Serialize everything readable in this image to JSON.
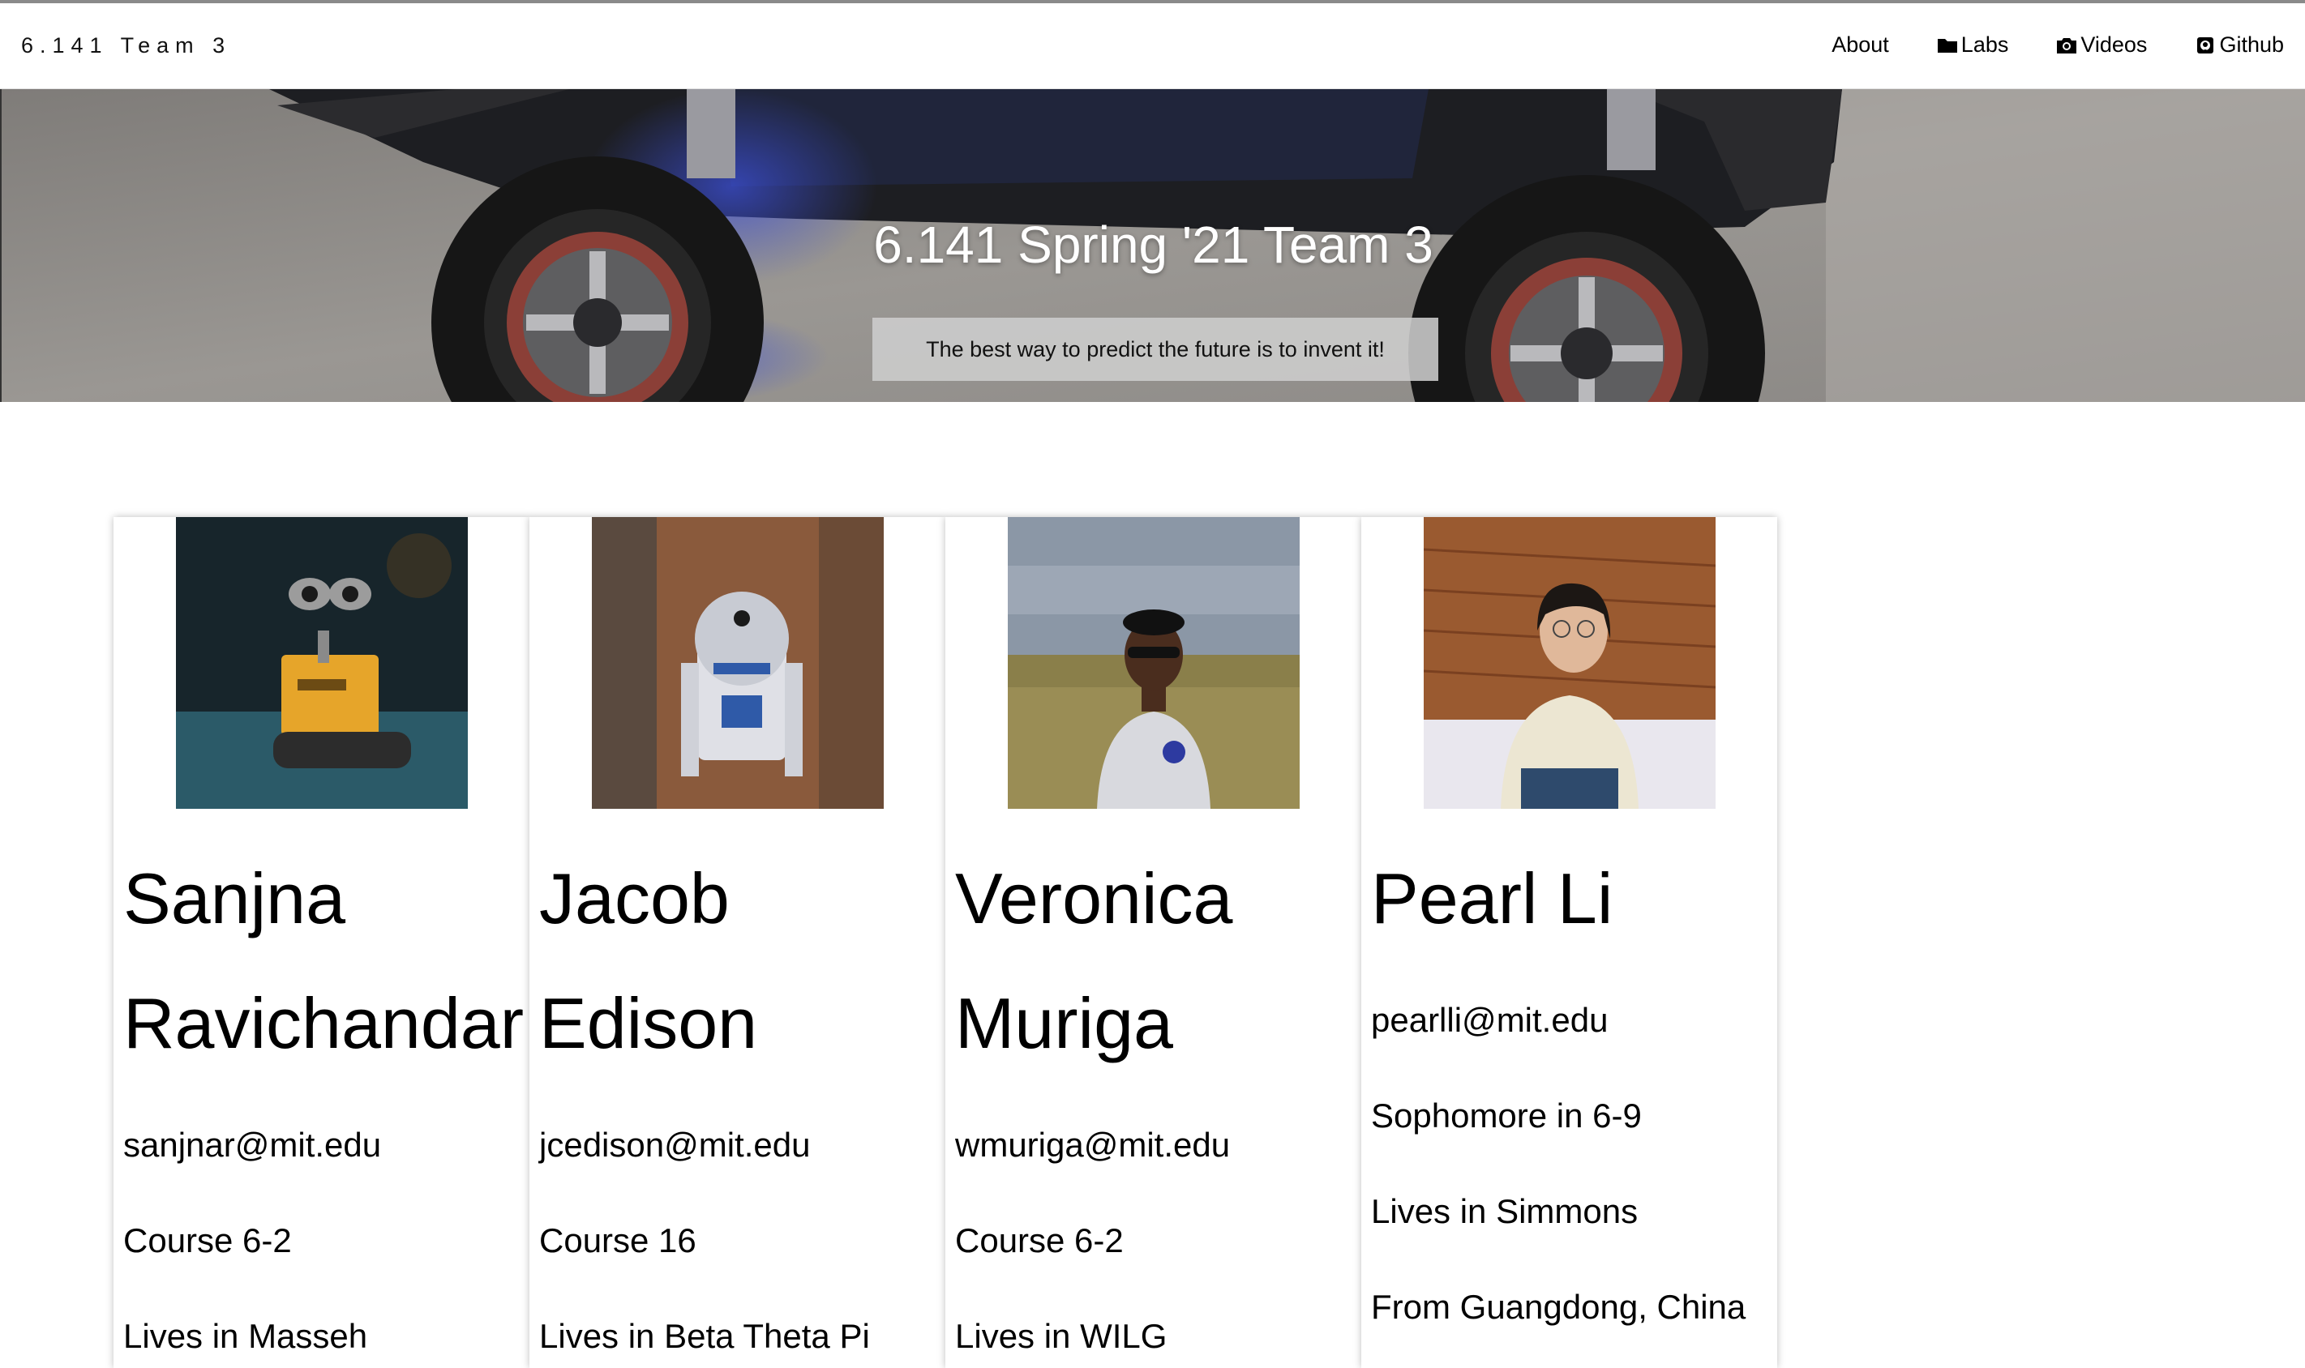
{
  "navbar": {
    "brand": "6.141 Team 3",
    "links": [
      {
        "label": "About",
        "icon": ""
      },
      {
        "label": "Labs",
        "icon": "folder-icon"
      },
      {
        "label": "Videos",
        "icon": "camera-icon"
      },
      {
        "label": "Github",
        "icon": "github-icon"
      }
    ]
  },
  "hero": {
    "title": "6.141 Spring '21 Team 3",
    "quote": "The best way to predict the future is to invent it!"
  },
  "team": [
    {
      "name_line1": "Sanjna",
      "name_line2": "Ravichandar",
      "email": "sanjnar@mit.edu",
      "detail1": "Course 6-2",
      "detail2": "Lives in Masseh",
      "photo": "wall-e-robot-photo"
    },
    {
      "name_line1": "Jacob",
      "name_line2": "Edison",
      "email": "jcedison@mit.edu",
      "detail1": "Course 16",
      "detail2": "Lives in Beta Theta Pi",
      "photo": "r2d2-robot-photo"
    },
    {
      "name_line1": "Veronica",
      "name_line2": "Muriga",
      "email": "wmuriga@mit.edu",
      "detail1": "Course 6-2",
      "detail2": "Lives in WILG",
      "photo": "portrait-photo"
    },
    {
      "name_line1": "Pearl Li",
      "email": "pearlli@mit.edu",
      "detail1": "Sophomore in 6-9",
      "detail2": "Lives in Simmons",
      "detail3": "From Guangdong, China",
      "photo": "portrait-photo"
    }
  ]
}
